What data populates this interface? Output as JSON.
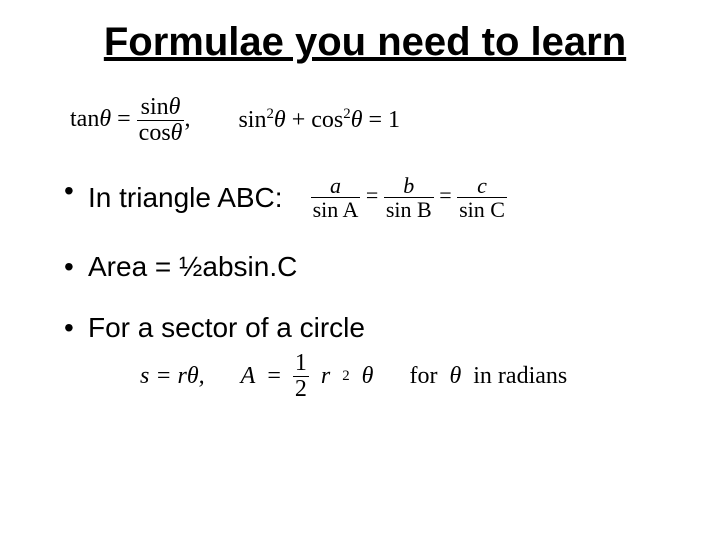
{
  "title": "Formulae you need to learn",
  "identity": {
    "tan_lhs": "tan",
    "theta": "θ",
    "eq": "=",
    "sin": "sin",
    "cos": "cos",
    "comma": ",",
    "sinsq": "sin",
    "plus": "+",
    "cossq": "cos",
    "eq1": "= 1",
    "sq": "2"
  },
  "triangle": {
    "label": "In triangle ABC:",
    "a": "a",
    "b": "b",
    "c": "c",
    "sinA": "sin A",
    "sinB": "sin B",
    "sinC": "sin C",
    "eq": "="
  },
  "area": {
    "text": "Area = ½absin.C"
  },
  "sector": {
    "label": "For a sector of a circle",
    "s_eq": "s = rθ,",
    "A": "A",
    "eq": "=",
    "one": "1",
    "two": "2",
    "r": "r",
    "sq": "2",
    "theta": "θ",
    "for_text": "for",
    "in_radians": "in radians"
  }
}
